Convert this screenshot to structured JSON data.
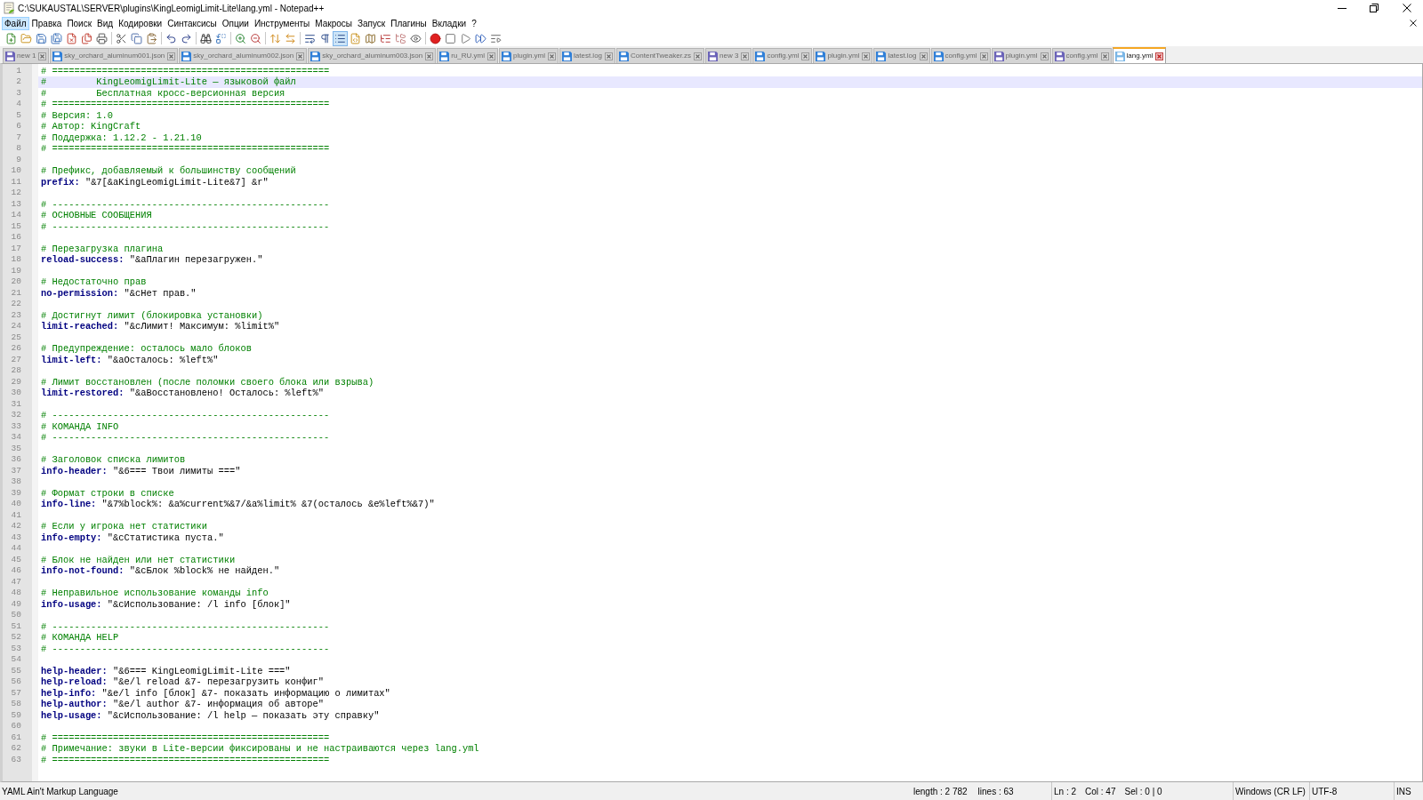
{
  "window": {
    "title": "C:\\SUKAUSTAL\\SERVER\\plugins\\KingLeomigLimit-Lite\\lang.yml - Notepad++"
  },
  "menu": [
    {
      "label": "Файл",
      "selected": true
    },
    {
      "label": "Правка",
      "selected": false
    },
    {
      "label": "Поиск",
      "selected": false
    },
    {
      "label": "Вид",
      "selected": false
    },
    {
      "label": "Кодировки",
      "selected": false
    },
    {
      "label": "Синтаксисы",
      "selected": false
    },
    {
      "label": "Опции",
      "selected": false
    },
    {
      "label": "Инструменты",
      "selected": false
    },
    {
      "label": "Макросы",
      "selected": false
    },
    {
      "label": "Запуск",
      "selected": false
    },
    {
      "label": "Плагины",
      "selected": false
    },
    {
      "label": "Вкладки",
      "selected": false
    },
    {
      "label": "?",
      "selected": false
    }
  ],
  "toolbar": [
    [
      {
        "kind": "new_file",
        "pressed": false
      },
      {
        "kind": "open",
        "pressed": false
      },
      {
        "kind": "save",
        "pressed": false
      },
      {
        "kind": "save_all",
        "pressed": false
      },
      {
        "kind": "close",
        "pressed": false
      },
      {
        "kind": "close_all",
        "pressed": false
      },
      {
        "kind": "print",
        "pressed": false
      }
    ],
    [
      {
        "kind": "cut",
        "pressed": false
      },
      {
        "kind": "copy",
        "pressed": false
      },
      {
        "kind": "paste",
        "pressed": false
      }
    ],
    [
      {
        "kind": "undo",
        "pressed": false
      },
      {
        "kind": "redo",
        "pressed": false
      }
    ],
    [
      {
        "kind": "find",
        "pressed": false
      },
      {
        "kind": "replace",
        "pressed": false
      }
    ],
    [
      {
        "kind": "zoom_in",
        "pressed": false
      },
      {
        "kind": "zoom_out",
        "pressed": false
      }
    ],
    [
      {
        "kind": "sync_vertical",
        "pressed": false
      },
      {
        "kind": "sync_horizontal",
        "pressed": false
      }
    ],
    [
      {
        "kind": "word_wrap",
        "pressed": false
      },
      {
        "kind": "all_chars",
        "pressed": false
      },
      {
        "kind": "indent_guide",
        "pressed": true
      },
      {
        "kind": "udl",
        "pressed": false
      },
      {
        "kind": "doc_map",
        "pressed": false
      },
      {
        "kind": "function_list",
        "pressed": false
      },
      {
        "kind": "folder_workspace",
        "pressed": false
      },
      {
        "kind": "monitoring",
        "pressed": false
      }
    ],
    [
      {
        "kind": "record",
        "pressed": false
      },
      {
        "kind": "stop",
        "pressed": false
      },
      {
        "kind": "playback",
        "pressed": false
      },
      {
        "kind": "run_multiple",
        "pressed": false
      },
      {
        "kind": "save_macro",
        "pressed": false
      }
    ]
  ],
  "tabs": [
    {
      "label": "new 1",
      "color": "#6a62b8",
      "selected": false
    },
    {
      "label": "sky_orchard_aluminum001.json",
      "color": "#2f7fd8",
      "selected": false
    },
    {
      "label": "sky_orchard_aluminum002.json",
      "color": "#2f7fd8",
      "selected": false
    },
    {
      "label": "sky_orchard_aluminum003.json",
      "color": "#2f7fd8",
      "selected": false
    },
    {
      "label": "ru_RU.yml",
      "color": "#2f7fd8",
      "selected": false
    },
    {
      "label": "plugin.yml",
      "color": "#2f7fd8",
      "selected": false
    },
    {
      "label": "latest.log",
      "color": "#2f7fd8",
      "selected": false
    },
    {
      "label": "ContentTweaker.zs",
      "color": "#2f7fd8",
      "selected": false
    },
    {
      "label": "new 3",
      "color": "#6a62b8",
      "selected": false
    },
    {
      "label": "config.yml",
      "color": "#2f7fd8",
      "selected": false
    },
    {
      "label": "plugin.yml",
      "color": "#2f7fd8",
      "selected": false
    },
    {
      "label": "latest.log",
      "color": "#2f7fd8",
      "selected": false
    },
    {
      "label": "config.yml",
      "color": "#2f7fd8",
      "selected": false
    },
    {
      "label": "plugin.yml",
      "color": "#6a62b8",
      "selected": false
    },
    {
      "label": "config.yml",
      "color": "#6a62b8",
      "selected": false
    },
    {
      "label": "lang.yml",
      "color": "#7ab6e6",
      "selected": true
    }
  ],
  "editor": {
    "lines": [
      {
        "number": "1",
        "kind": "comment",
        "text": "# ==================================================",
        "current": false
      },
      {
        "number": "2",
        "kind": "comment",
        "text": "#         KingLeomigLimit-Lite — языковой файл",
        "current": true
      },
      {
        "number": "3",
        "kind": "comment",
        "text": "#         Бесплатная кросс-версионная версия",
        "current": false
      },
      {
        "number": "4",
        "kind": "comment",
        "text": "# ==================================================",
        "current": false
      },
      {
        "number": "5",
        "kind": "comment",
        "text": "# Версия: 1.0",
        "current": false
      },
      {
        "number": "6",
        "kind": "comment",
        "text": "# Автор: KingCraft",
        "current": false
      },
      {
        "number": "7",
        "kind": "comment",
        "text": "# Поддержка: 1.12.2 - 1.21.10",
        "current": false
      },
      {
        "number": "8",
        "kind": "comment",
        "text": "# ==================================================",
        "current": false
      },
      {
        "number": "9",
        "kind": "blank",
        "current": false
      },
      {
        "number": "10",
        "kind": "comment",
        "text": "# Префикс, добавляемый к большинству сообщений",
        "current": false
      },
      {
        "number": "11",
        "kind": "pair",
        "key": "prefix:",
        "value": "\"&7[&aKingLeomigLimit-Lite&7] &r\"",
        "current": false
      },
      {
        "number": "12",
        "kind": "blank",
        "current": false
      },
      {
        "number": "13",
        "kind": "comment",
        "text": "# --------------------------------------------------",
        "current": false
      },
      {
        "number": "14",
        "kind": "comment",
        "text": "# ОСНОВНЫЕ СООБЩЕНИЯ",
        "current": false
      },
      {
        "number": "15",
        "kind": "comment",
        "text": "# --------------------------------------------------",
        "current": false
      },
      {
        "number": "16",
        "kind": "blank",
        "current": false
      },
      {
        "number": "17",
        "kind": "comment",
        "text": "# Перезагрузка плагина",
        "current": false
      },
      {
        "number": "18",
        "kind": "pair",
        "key": "reload-success:",
        "value": "\"&aПлагин перезагружен.\"",
        "current": false
      },
      {
        "number": "19",
        "kind": "blank",
        "current": false
      },
      {
        "number": "20",
        "kind": "comment",
        "text": "# Недостаточно прав",
        "current": false
      },
      {
        "number": "21",
        "kind": "pair",
        "key": "no-permission:",
        "value": "\"&cНет прав.\"",
        "current": false
      },
      {
        "number": "22",
        "kind": "blank",
        "current": false
      },
      {
        "number": "23",
        "kind": "comment",
        "text": "# Достигнут лимит (блокировка установки)",
        "current": false
      },
      {
        "number": "24",
        "kind": "pair",
        "key": "limit-reached:",
        "value": "\"&cЛимит! Максимум: %limit%\"",
        "current": false
      },
      {
        "number": "25",
        "kind": "blank",
        "current": false
      },
      {
        "number": "26",
        "kind": "comment",
        "text": "# Предупреждение: осталось мало блоков",
        "current": false
      },
      {
        "number": "27",
        "kind": "pair",
        "key": "limit-left:",
        "value": "\"&aОсталось: %left%\"",
        "current": false
      },
      {
        "number": "28",
        "kind": "blank",
        "current": false
      },
      {
        "number": "29",
        "kind": "comment",
        "text": "# Лимит восстановлен (после поломки своего блока или взрыва)",
        "current": false
      },
      {
        "number": "30",
        "kind": "pair",
        "key": "limit-restored:",
        "value": "\"&aВосстановлено! Осталось: %left%\"",
        "current": false
      },
      {
        "number": "31",
        "kind": "blank",
        "current": false
      },
      {
        "number": "32",
        "kind": "comment",
        "text": "# --------------------------------------------------",
        "current": false
      },
      {
        "number": "33",
        "kind": "comment",
        "text": "# КОМАНДА INFO",
        "current": false
      },
      {
        "number": "34",
        "kind": "comment",
        "text": "# --------------------------------------------------",
        "current": false
      },
      {
        "number": "35",
        "kind": "blank",
        "current": false
      },
      {
        "number": "36",
        "kind": "comment",
        "text": "# Заголовок списка лимитов",
        "current": false
      },
      {
        "number": "37",
        "kind": "pair",
        "key": "info-header:",
        "value": "\"&6=== Твои лимиты ===\"",
        "current": false
      },
      {
        "number": "38",
        "kind": "blank",
        "current": false
      },
      {
        "number": "39",
        "kind": "comment",
        "text": "# Формат строки в списке",
        "current": false
      },
      {
        "number": "40",
        "kind": "pair",
        "key": "info-line:",
        "value": "\"&7%block%: &a%current%&7/&a%limit% &7(осталось &e%left%&7)\"",
        "current": false
      },
      {
        "number": "41",
        "kind": "blank",
        "current": false
      },
      {
        "number": "42",
        "kind": "comment",
        "text": "# Если у игрока нет статистики",
        "current": false
      },
      {
        "number": "43",
        "kind": "pair",
        "key": "info-empty:",
        "value": "\"&cСтатистика пуста.\"",
        "current": false
      },
      {
        "number": "44",
        "kind": "blank",
        "current": false
      },
      {
        "number": "45",
        "kind": "comment",
        "text": "# Блок не найден или нет статистики",
        "current": false
      },
      {
        "number": "46",
        "kind": "pair",
        "key": "info-not-found:",
        "value": "\"&cБлок %block% не найден.\"",
        "current": false
      },
      {
        "number": "47",
        "kind": "blank",
        "current": false
      },
      {
        "number": "48",
        "kind": "comment",
        "text": "# Неправильное использование команды info",
        "current": false
      },
      {
        "number": "49",
        "kind": "pair",
        "key": "info-usage:",
        "value": "\"&cИспользование: /l info [блок]\"",
        "current": false
      },
      {
        "number": "50",
        "kind": "blank",
        "current": false
      },
      {
        "number": "51",
        "kind": "comment",
        "text": "# --------------------------------------------------",
        "current": false
      },
      {
        "number": "52",
        "kind": "comment",
        "text": "# КОМАНДА HELP",
        "current": false
      },
      {
        "number": "53",
        "kind": "comment",
        "text": "# --------------------------------------------------",
        "current": false
      },
      {
        "number": "54",
        "kind": "blank",
        "current": false
      },
      {
        "number": "55",
        "kind": "pair",
        "key": "help-header:",
        "value": "\"&6=== KingLeomigLimit-Lite ===\"",
        "current": false
      },
      {
        "number": "56",
        "kind": "pair",
        "key": "help-reload:",
        "value": "\"&e/l reload &7- перезагрузить конфиг\"",
        "current": false
      },
      {
        "number": "57",
        "kind": "pair",
        "key": "help-info:",
        "value": "\"&e/l info [блок] &7- показать информацию о лимитах\"",
        "current": false
      },
      {
        "number": "58",
        "kind": "pair",
        "key": "help-author:",
        "value": "\"&e/l author &7- информация об авторе\"",
        "current": false
      },
      {
        "number": "59",
        "kind": "pair",
        "key": "help-usage:",
        "value": "\"&cИспользование: /l help — показать эту справку\"",
        "current": false
      },
      {
        "number": "60",
        "kind": "blank",
        "current": false
      },
      {
        "number": "61",
        "kind": "comment",
        "text": "# ==================================================",
        "current": false
      },
      {
        "number": "62",
        "kind": "comment",
        "text": "# Примечание: звуки в Lite-версии фиксированы и не настраиваются через lang.yml",
        "current": false
      },
      {
        "number": "63",
        "kind": "comment",
        "text": "# ==================================================",
        "current": false
      }
    ]
  },
  "status_bar": {
    "language": "YAML Ain't Markup Language",
    "length": "length : 2 782",
    "lines": "lines : 63",
    "ln": "Ln : 2",
    "col": "Col : 47",
    "sel": "Sel : 0 | 0",
    "eol": "Windows (CR LF)",
    "encoding": "UTF-8",
    "mode": "INS"
  }
}
